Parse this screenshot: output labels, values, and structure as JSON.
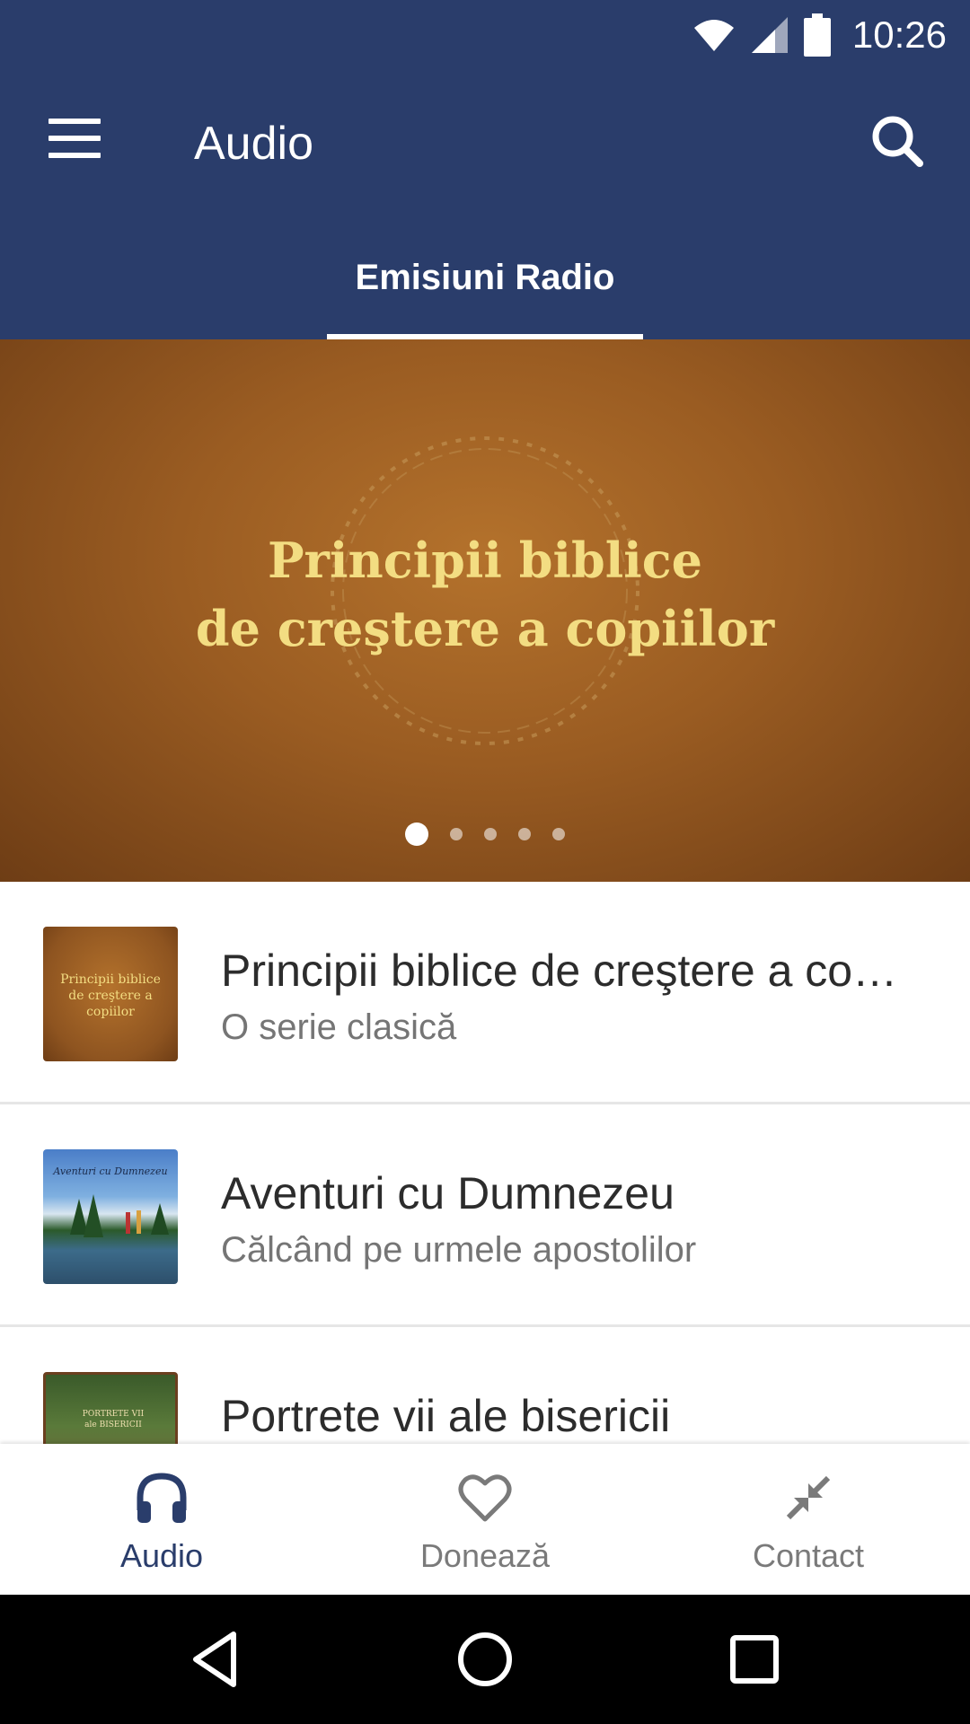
{
  "status": {
    "time": "10:26"
  },
  "appbar": {
    "title": "Audio"
  },
  "tabs": [
    {
      "label": "Emisiuni Radio",
      "active": true
    }
  ],
  "banner": {
    "title_line1": "Principii biblice",
    "title_line2": "de creştere a copiilor",
    "page_count": 5,
    "active_page": 1
  },
  "list": {
    "items": [
      {
        "title": "Principii biblice de creştere a co…",
        "subtitle": "O serie clasică",
        "thumb_text": [
          "Principii biblice",
          "de creştere a copiilor"
        ]
      },
      {
        "title": "Aventuri cu Dumnezeu",
        "subtitle": "Călcând pe urmele apostolilor",
        "thumb_text": [
          "Aventuri cu Dumnezeu"
        ]
      },
      {
        "title": "Portrete vii ale bisericii",
        "subtitle": "",
        "thumb_text": [
          "PORTRETE VII",
          "ale BISERICII"
        ]
      }
    ]
  },
  "bottom_nav": [
    {
      "label": "Audio",
      "icon": "headphones-icon",
      "active": true
    },
    {
      "label": "Donează",
      "icon": "heart-icon",
      "active": false
    },
    {
      "label": "Contact",
      "icon": "collapse-arrows-icon",
      "active": false
    }
  ],
  "colors": {
    "primary": "#2a3d6b",
    "banner_text": "#f3dd82",
    "inactive": "#7a7a7a"
  }
}
